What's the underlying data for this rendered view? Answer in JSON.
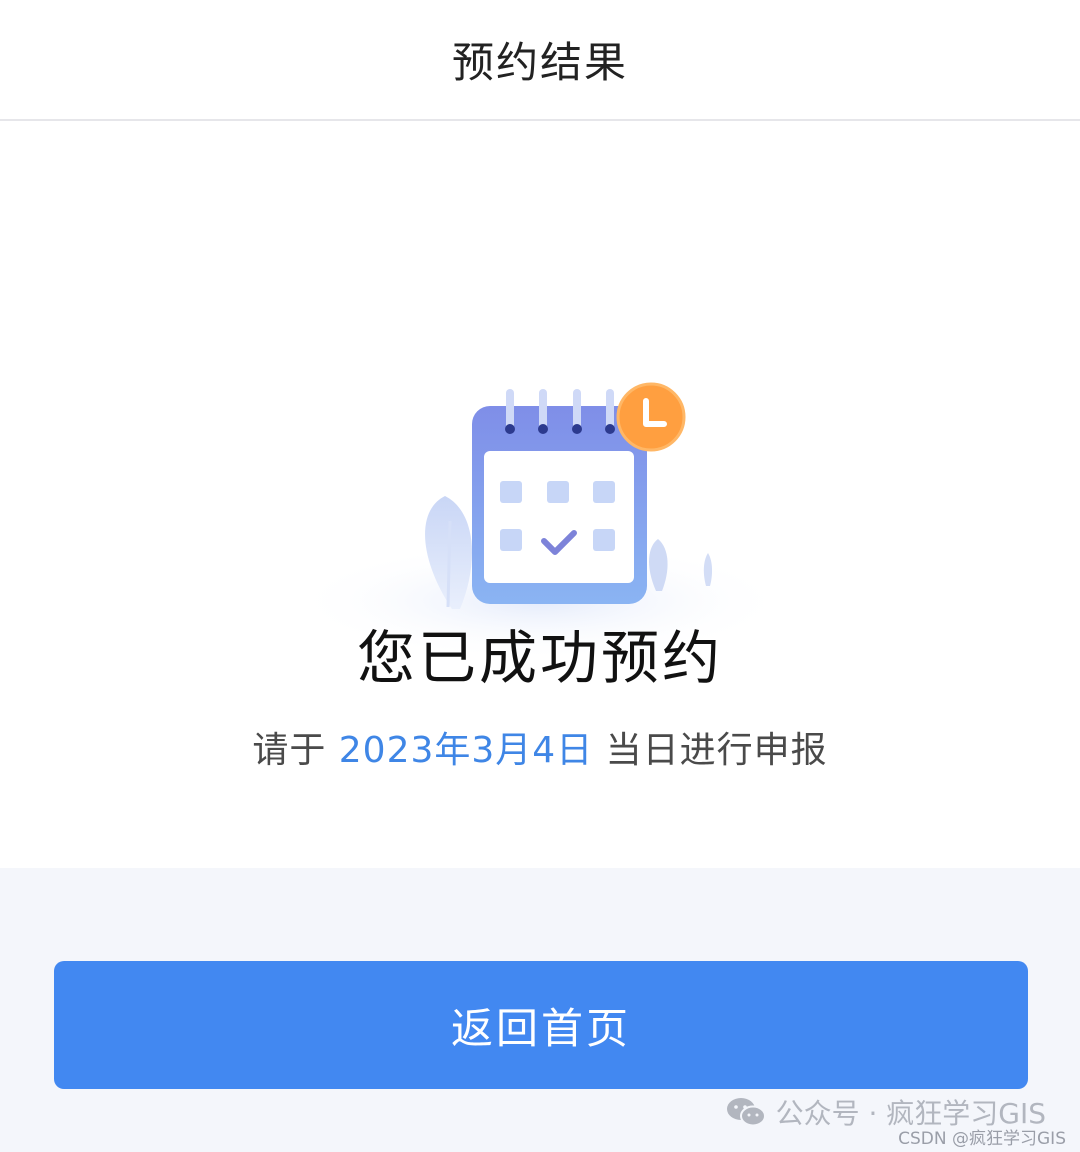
{
  "header": {
    "title": "预约结果"
  },
  "result": {
    "title": "您已成功预约",
    "sub_prefix": "请于",
    "date": "2023年3月4日",
    "sub_suffix": "当日进行申报"
  },
  "actions": {
    "home_label": "返回首页"
  },
  "watermark": {
    "main": "公众号 · 疯狂学习GIS",
    "small": "CSDN @疯狂学习GIS"
  },
  "icons": {
    "illustration": "calendar-check-clock-icon",
    "wechat": "wechat-icon"
  },
  "colors": {
    "accent": "#4288f1",
    "date": "#3f86e6",
    "clock": "#ff9f40"
  }
}
